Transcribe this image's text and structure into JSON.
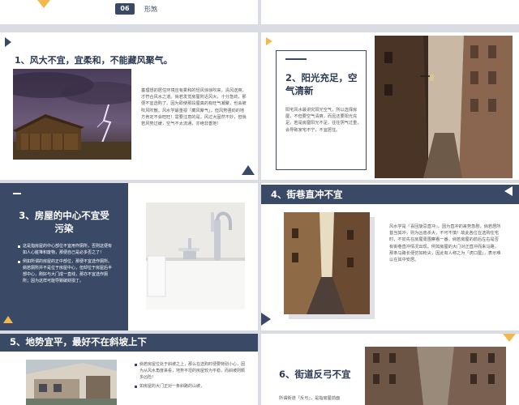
{
  "top": {
    "number": "06",
    "label": "形煞"
  },
  "s1": {
    "title": "1、风大不宜，宜柔和，不能藏风聚气。",
    "body": "基理想的居住环境应有柔和的轻风徐徐吹来，清风送爽，才符合风水之道。倘若发觉房屋附近风大，十分急劲，那便不宜选购了。因为即使那段屋真的有旺气凝聚，也会被吹风吹散。风水学最重视「藏风聚气」，但风势强劲的地方肯定不会旺旺！需要注意的是，风过大固然不妙，但倘若风势过缓，空气不太流通，亦绝非善地！"
  },
  "s2": {
    "title": "2、阳光充足，空气清新",
    "body": "阳宅风水最讲究阳光空气，所以选择房屋，不但要空气清爽，而且还要阳光充足。若是房屋阳光不足，往往阴气过重，会导致家宅不宁，不宜居住。"
  },
  "s3": {
    "title": "3、房屋的中心不宜受污染",
    "bullets": [
      "这是指房屋的中心部位不宜用作厕所，否则这便有如人心脏堆积废物，那便自己是必多否之了！",
      "例如所谓的房屋的正中部位，那便不宜选作厕所。倘若厕所并不是位于房屋中心，但却位于房屋后半部中心，刚好与大门成一直线，那亦不宜选作厕所；因为这样可能导致破财损丁。"
    ]
  },
  "s4": {
    "title": "4、街巷直冲不宜",
    "body": "风水学是『喜回旋忌直冲』，因为直冲的来势急剧，倘若居所首当其冲，则为凶兽杀大，不可不慎！故此各位在选购住宅时，不妨先在房屋周围察看一番，倘若房屋的前后左右是否有街巷直冲情况出现。例如房屋的大门对正直冲而来马路，那条马路长便仿如枪尖，因此有人称之为「虎口屋」，表示难以在其中安居。"
  },
  "s5": {
    "title": "5、地势宜平，最好不在斜坡上下",
    "bullets": [
      "倘若房屋位处于斜坡之上，那么在选购时便要特别小心，因为从风水角度来看，地势平坦的房屋较为平稳，而斜坡则颇多凶险！",
      "如房屋的大门正对一条斜路的山坡，"
    ]
  },
  "s6": {
    "title": "6、街道反弓不宜",
    "body": "所谓街道「反弓」，是指房屋前面"
  },
  "colors": {
    "navy": "#3a4a66",
    "gold": "#f2b84b",
    "bg": "#d9dce3"
  }
}
